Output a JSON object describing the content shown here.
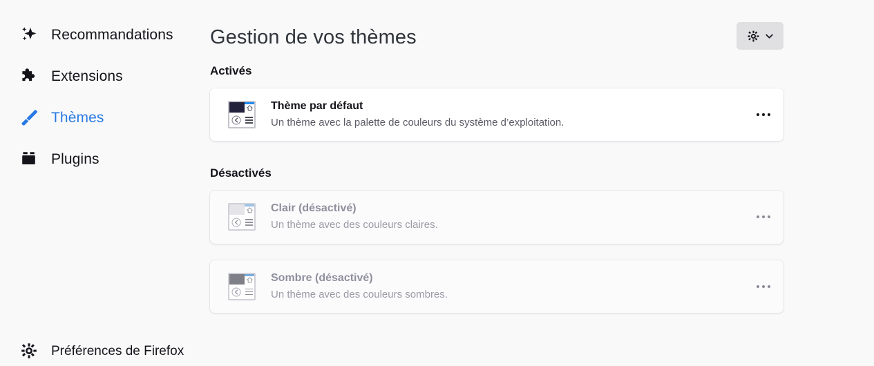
{
  "sidebar": {
    "items": [
      {
        "label": "Recommandations",
        "icon": "sparkle-icon",
        "active": false
      },
      {
        "label": "Extensions",
        "icon": "puzzle-icon",
        "active": false
      },
      {
        "label": "Thèmes",
        "icon": "paintbrush-icon",
        "active": true
      },
      {
        "label": "Plugins",
        "icon": "plugin-icon",
        "active": false
      }
    ],
    "footer": {
      "label": "Préférences de Firefox",
      "icon": "gear-icon"
    }
  },
  "header": {
    "title": "Gestion de vos thèmes",
    "settings_button": {
      "icon": "gear-icon",
      "chevron": "chevron-down-icon"
    }
  },
  "sections": [
    {
      "heading": "Activés",
      "themes": [
        {
          "name": "Thème par défaut",
          "description": "Un thème avec la palette de couleurs du système d’exploitation.",
          "disabled": false,
          "thumbnail": {
            "top_color": "#22223c",
            "accent_color": "#1f8af0"
          },
          "more_button": "more-options-icon"
        }
      ]
    },
    {
      "heading": "Désactivés",
      "themes": [
        {
          "name": "Clair (désactivé)",
          "description": "Un thème avec des couleurs claires.",
          "disabled": true,
          "thumbnail": {
            "top_color": "#e3e3e8",
            "accent_color": "#8cbdea"
          },
          "more_button": "more-options-icon"
        },
        {
          "name": "Sombre (désactivé)",
          "description": "Un thème avec des couleurs sombres.",
          "disabled": true,
          "thumbnail": {
            "top_color": "#75757e",
            "accent_color": "#6ba6e0"
          },
          "more_button": "more-options-icon"
        }
      ]
    }
  ],
  "colors": {
    "page_background": "#f9f9fa",
    "card_background": "#ffffff",
    "accent": "#2a7ae4",
    "text_primary": "#15141a",
    "text_secondary": "#5b5b66",
    "text_disabled": "#8f8f9d"
  }
}
